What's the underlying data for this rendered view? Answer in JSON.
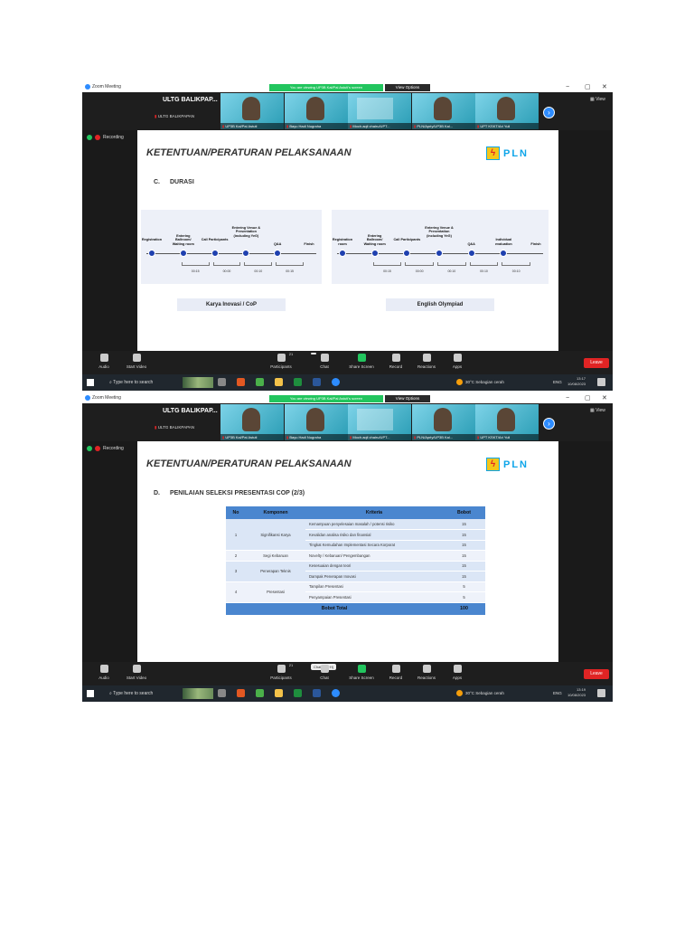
{
  "shots": [
    {
      "window_title": "Zoom Meeting",
      "banner": "You are viewing UP3B Kal/Pal Astuti's screen",
      "view_options": "View Options",
      "win_min": "−",
      "win_max": "▢",
      "win_close": "✕",
      "meeting_title": "ULTG BALIKPAP...",
      "meeting_subtitle": "ULTG BALIKPAPAN",
      "strip_view": "View",
      "participants": [
        "UP3B Kal/Pal Astuti",
        "Bayu Hadi Nugraha",
        "Moch.aqil chairu/UPT...",
        "PLN/Apriy/UP3B Kal...",
        "UPT KSKT/Ari Yuli"
      ],
      "recording": "Recording",
      "slide": {
        "title": "KETENTUAN/PERATURAN PELAKSANAAN",
        "logo_text": "PLN",
        "section_letter": "C.",
        "section_title": "DURASI",
        "timeline_left": {
          "steps": [
            "Registration",
            "Entering Ballroom/ Waiting room",
            "Call Participants",
            "Entering Venue & Presentation (including YeG)",
            "Q&A",
            "Finish"
          ],
          "times": [
            "00:15",
            "00:00",
            "00:10",
            "00:15"
          ],
          "caption": "Karya Inovasi / CoP"
        },
        "timeline_right": {
          "steps": [
            "Registration room",
            "Entering Ballroom/ Waiting room",
            "Call Participants",
            "Entering Venue & Presentation (including YeG)",
            "Q&A",
            "Individual evaluation",
            "Finish"
          ],
          "times": [
            "00:15",
            "00:00",
            "00:10",
            "00:10",
            "00:10"
          ],
          "caption": "English Olympiad"
        }
      },
      "toolbar": {
        "audio": "Audio",
        "video": "Start Video",
        "participants": "Participants",
        "participants_count": "21",
        "chat": "Chat",
        "share": "Share Screen",
        "record": "Record",
        "reactions": "Reactions",
        "apps": "Apps",
        "leave": "Leave",
        "chat_tip": ""
      },
      "taskbar": {
        "search": "Type here to search",
        "weather": "30°C  Sebagian cerah",
        "lang": "ENG",
        "time": "13:17",
        "date": "10/08/2023"
      }
    },
    {
      "window_title": "Zoom Meeting",
      "banner": "You are viewing UP3B Kal/Pal Astuti's screen",
      "view_options": "View Options",
      "win_min": "−",
      "win_max": "▢",
      "win_close": "✕",
      "meeting_title": "ULTG BALIKPAP...",
      "meeting_subtitle": "ULTG BALIKPAPAN",
      "strip_view": "View",
      "participants": [
        "UP3B Kal/Pal Astuti",
        "Bayu Hadi Nugraha",
        "Moch.aqil chairu/UPT...",
        "PLN/Apriy/UP3B Kal...",
        "UPT KSKT/Ari Yuli"
      ],
      "recording": "Recording",
      "slide": {
        "title": "KETENTUAN/PERATURAN PELAKSANAAN",
        "logo_text": "PLN",
        "section_letter": "D.",
        "section_title": "PENILAIAN SELEKSI PRESENTASI COP (2/3)",
        "table": {
          "headers": [
            "No",
            "Komponen",
            "Kriteria",
            "Bobot"
          ],
          "groups": [
            {
              "no": "1",
              "komponen": "Signifikansi Karya",
              "rows": [
                {
                  "kriteria": "Kemampuan penyelesaian masalah / potensi risiko",
                  "bobot": "15"
                },
                {
                  "kriteria": "Kevalidan analisa risiko dan finansial",
                  "bobot": "15"
                },
                {
                  "kriteria": "Tingkat Kemudahan Implementasi Secara Korporat",
                  "bobot": "15"
                }
              ]
            },
            {
              "no": "2",
              "komponen": "Segi Kebaruan",
              "rows": [
                {
                  "kriteria": "Novelty / Kebaruan/ Pengembangan",
                  "bobot": "15"
                }
              ]
            },
            {
              "no": "3",
              "komponen": "Penerapan Teknis",
              "rows": [
                {
                  "kriteria": "Kesesuaian dengan teori",
                  "bobot": "15"
                },
                {
                  "kriteria": "Dampak Penerapan Inovasi",
                  "bobot": "15"
                }
              ]
            },
            {
              "no": "4",
              "komponen": "Presentasi",
              "rows": [
                {
                  "kriteria": "Tampilan Presentasi",
                  "bobot": "5"
                },
                {
                  "kriteria": "Penyampaian Presentasi",
                  "bobot": "5"
                }
              ]
            }
          ],
          "total_label": "Bobot Total",
          "total_value": "100"
        }
      },
      "toolbar": {
        "audio": "Audio",
        "video": "Start Video",
        "participants": "Participants",
        "participants_count": "21",
        "chat": "Chat",
        "share": "Share Screen",
        "record": "Record",
        "reactions": "Reactions",
        "apps": "Apps",
        "leave": "Leave",
        "chat_tip": "Chat (Alt+H)"
      },
      "taskbar": {
        "search": "Type here to search",
        "weather": "30°C  Sebagian cerah",
        "lang": "ENG",
        "time": "13:19",
        "date": "10/08/2023"
      }
    }
  ],
  "colors": {
    "zoom_blue": "#2d8cff",
    "banner_green": "#22c55e",
    "leave_red": "#e02424",
    "table_header": "#4a86cf",
    "timeline_step": "#1e40af",
    "pln_blue": "#0ea5e9",
    "pln_yellow": "#f5c518"
  }
}
